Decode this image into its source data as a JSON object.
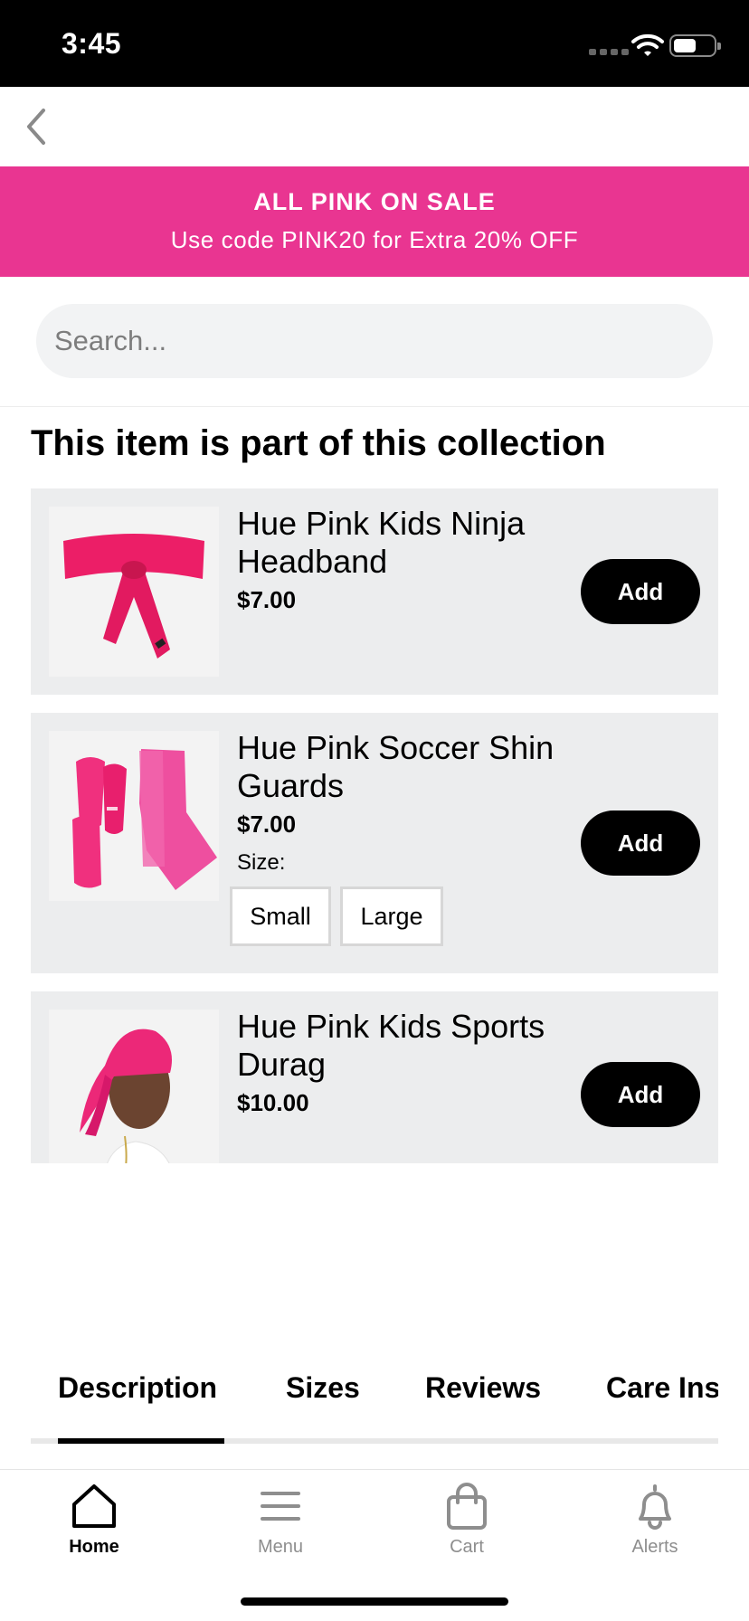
{
  "status_bar": {
    "time": "3:45"
  },
  "promo": {
    "title": "ALL PINK ON SALE",
    "subtitle": "Use code PINK20 for Extra 20% OFF",
    "background_color": "#e93591"
  },
  "search": {
    "placeholder": "Search..."
  },
  "collection": {
    "title": "This item is part of this collection",
    "products": [
      {
        "name": "Hue Pink Kids Ninja Headband",
        "price": "$7.00",
        "add_label": "Add"
      },
      {
        "name": "Hue Pink Soccer Shin Guards",
        "price": "$7.00",
        "add_label": "Add",
        "size_label": "Size:",
        "sizes": [
          "Small",
          "Large"
        ]
      },
      {
        "name": "Hue Pink Kids Sports Durag",
        "price": "$10.00",
        "add_label": "Add"
      }
    ]
  },
  "detail_tabs": [
    {
      "label": "Description",
      "active": true
    },
    {
      "label": "Sizes",
      "active": false
    },
    {
      "label": "Reviews",
      "active": false
    },
    {
      "label": "Care Ins",
      "active": false
    }
  ],
  "bottom_nav": [
    {
      "label": "Home",
      "icon": "home-icon",
      "active": true
    },
    {
      "label": "Menu",
      "icon": "menu-icon",
      "active": false
    },
    {
      "label": "Cart",
      "icon": "bag-icon",
      "active": false
    },
    {
      "label": "Alerts",
      "icon": "bell-icon",
      "active": false
    }
  ]
}
